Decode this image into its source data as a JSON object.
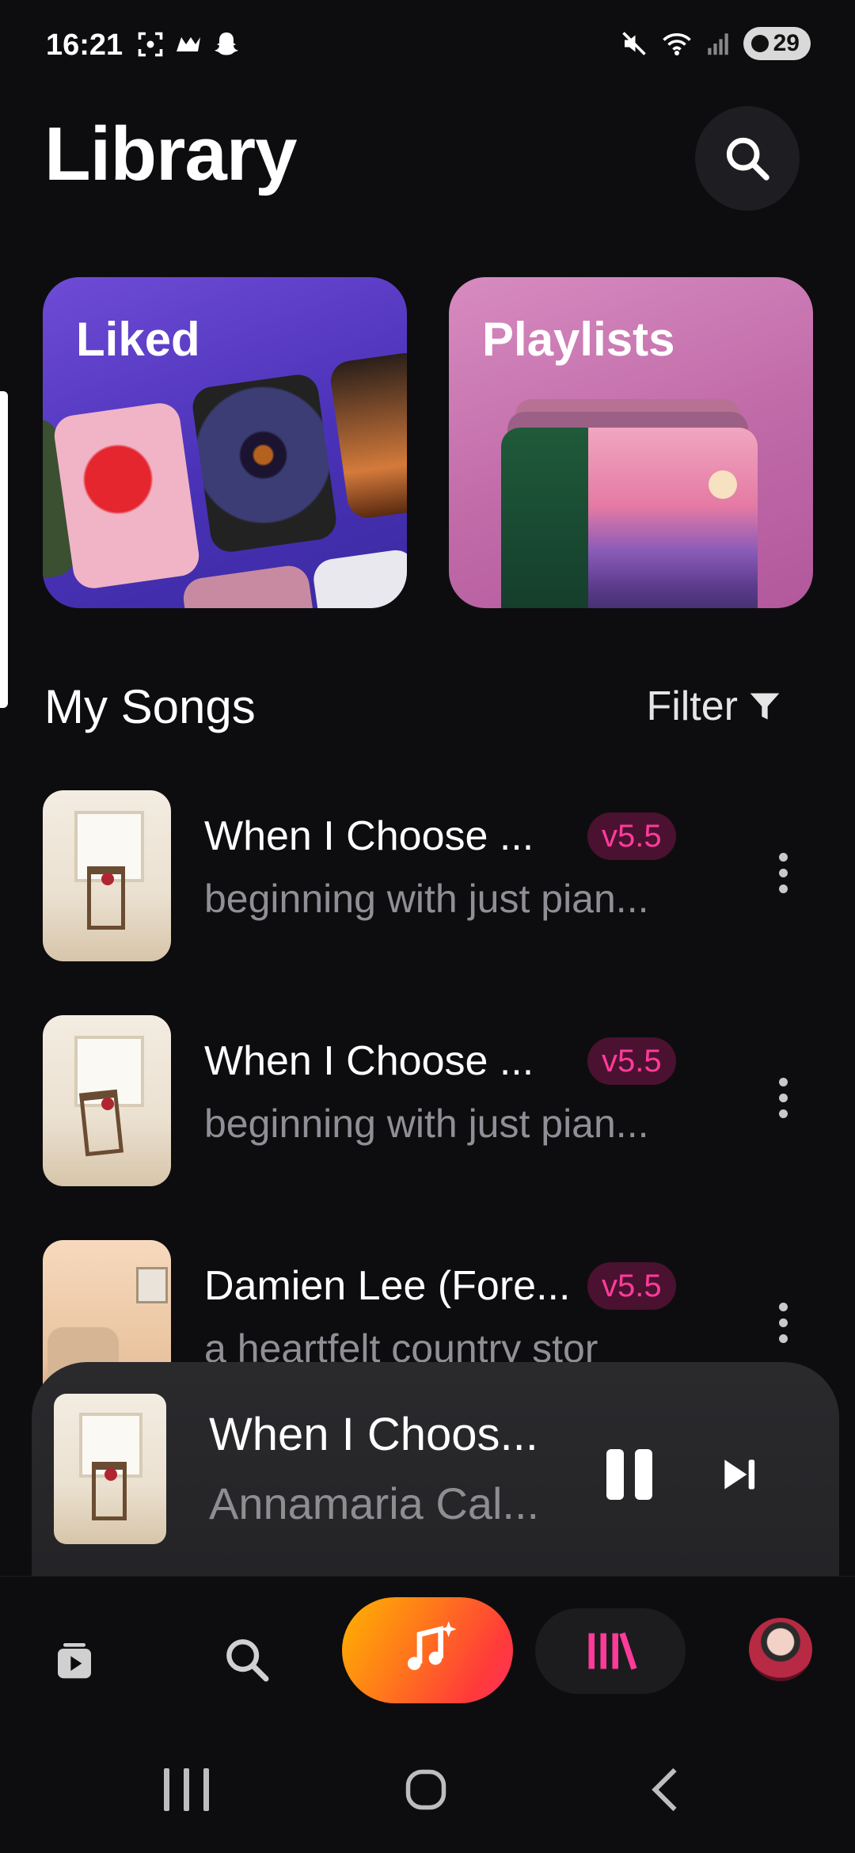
{
  "status_bar": {
    "time": "16:21",
    "battery": "29",
    "left_icons": [
      "screenshot-icon",
      "game-icon",
      "snapchat-icon"
    ],
    "right_icons": [
      "mute-icon",
      "wifi-icon",
      "signal-icon"
    ]
  },
  "header": {
    "title": "Library",
    "search_icon": "search-icon"
  },
  "categories": [
    {
      "label": "Liked"
    },
    {
      "label": "Playlists"
    }
  ],
  "section": {
    "title": "My Songs",
    "filter_label": "Filter"
  },
  "songs": [
    {
      "title": "When I Choose ...",
      "badge": "v5.5",
      "description": "beginning with just pian..."
    },
    {
      "title": "When I Choose ...",
      "badge": "v5.5",
      "description": "beginning with just pian..."
    },
    {
      "title": "Damien Lee (Fore...",
      "badge": "v5.5",
      "description": "a heartfelt country stor"
    }
  ],
  "now_playing": {
    "title": "When I Choos...",
    "artist": "Annamaria Cal..."
  },
  "bottom_nav": [
    "feed-icon",
    "search-icon",
    "create-icon",
    "library-icon",
    "avatar"
  ],
  "colors": {
    "background": "#0d0d0f",
    "accent_pink": "#ff3b9a",
    "badge_bg": "#4a1230",
    "create_gradient_start": "#ffb400",
    "create_gradient_end": "#ff2f5e"
  }
}
